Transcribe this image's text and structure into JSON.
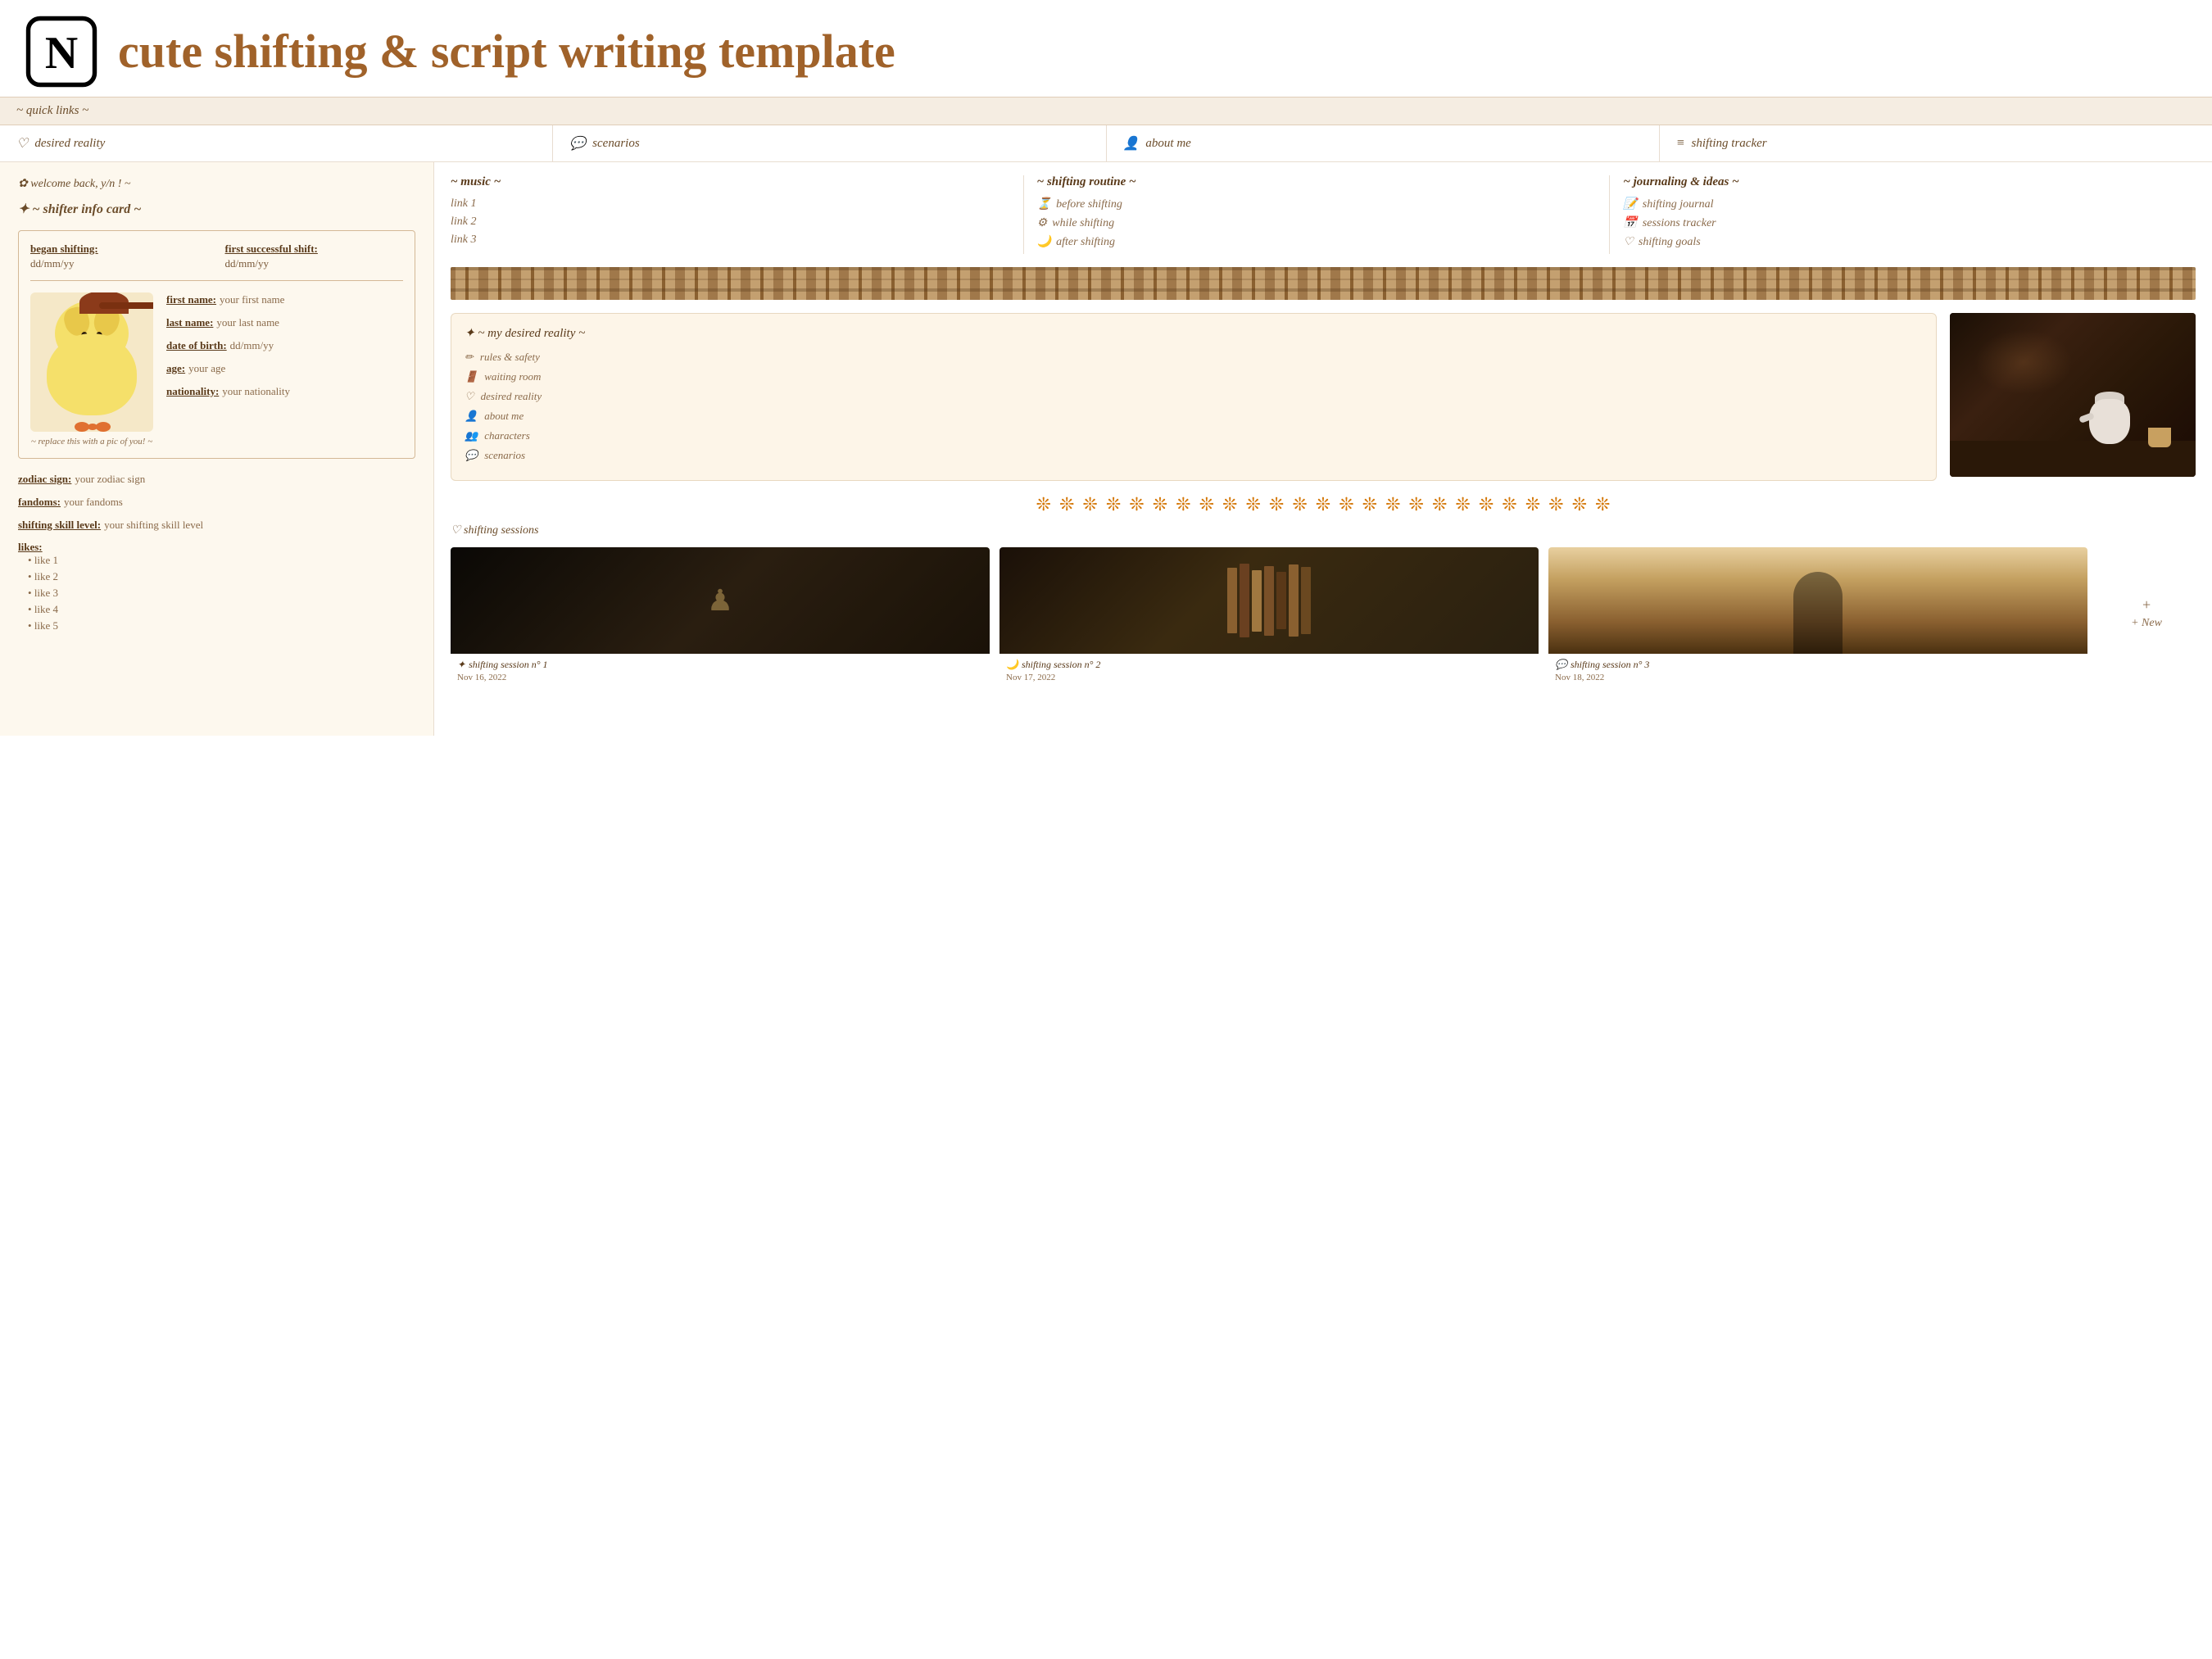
{
  "header": {
    "title": "cute shifting & script writing template",
    "notion_alt": "Notion logo"
  },
  "quick_links_bar": {
    "label": "~ quick links ~"
  },
  "quick_links": [
    {
      "id": "desired-reality",
      "icon": "♡",
      "label": "desired reality"
    },
    {
      "id": "scenarios",
      "icon": "💬",
      "label": "scenarios"
    },
    {
      "id": "about-me",
      "icon": "👤",
      "label": "about me"
    },
    {
      "id": "shifting-tracker",
      "icon": "≡",
      "label": "shifting tracker"
    }
  ],
  "left_panel": {
    "welcome": "✿  welcome back, y/n ! ~",
    "info_card_title": "✦  ~ shifter info card ~",
    "began_shifting_label": "began shifting:",
    "began_shifting_value": "dd/mm/yy",
    "first_shift_label": "first successful shift:",
    "first_shift_value": "dd/mm/yy",
    "image_caption": "~ replace this with a pic of you! ~",
    "fields": [
      {
        "label": "first name:",
        "value": "your first name"
      },
      {
        "label": "last name:",
        "value": "your last name"
      },
      {
        "label": "date of birth:",
        "value": "dd/mm/yy"
      },
      {
        "label": "age:",
        "value": "your age"
      },
      {
        "label": "nationality:",
        "value": "your nationality"
      }
    ],
    "bottom_fields": [
      {
        "label": "zodiac sign:",
        "value": "your zodiac sign"
      },
      {
        "label": "fandoms:",
        "value": "your fandoms"
      },
      {
        "label": "shifting skill level:",
        "value": "your shifting skill level"
      }
    ],
    "likes_label": "likes:",
    "likes": [
      "like 1",
      "like 2",
      "like 3",
      "like 4",
      "like 5"
    ]
  },
  "music_section": {
    "title": "~ music ~",
    "links": [
      "link 1",
      "link 2",
      "link 3"
    ]
  },
  "routine_section": {
    "title": "~ shifting routine ~",
    "items": [
      {
        "icon": "⏳",
        "label": "before shifting"
      },
      {
        "icon": "⚙",
        "label": "while shifting"
      },
      {
        "icon": "🌙",
        "label": "after shifting"
      }
    ]
  },
  "journaling_section": {
    "title": "~ journaling & ideas ~",
    "items": [
      {
        "icon": "📝",
        "label": "shifting journal"
      },
      {
        "icon": "📅",
        "label": "sessions tracker"
      },
      {
        "icon": "♡",
        "label": "shifting goals"
      }
    ]
  },
  "desired_reality": {
    "title": "✦  ~ my desired reality ~",
    "links": [
      {
        "icon": "✏",
        "label": "rules & safety"
      },
      {
        "icon": "🚪",
        "label": "waiting room"
      },
      {
        "icon": "♡",
        "label": "desired reality"
      },
      {
        "icon": "👤",
        "label": "about me"
      },
      {
        "icon": "👥",
        "label": "characters"
      },
      {
        "icon": "💬",
        "label": "scenarios"
      }
    ]
  },
  "flowers": [
    "❊",
    "❊",
    "❊",
    "❊",
    "❊",
    "❊",
    "❊",
    "❊",
    "❊",
    "❊",
    "❊",
    "❊",
    "❊",
    "❊",
    "❊",
    "❊",
    "❊",
    "❊",
    "❊",
    "❊",
    "❊",
    "❊",
    "❊",
    "❊",
    "❊"
  ],
  "sessions": {
    "header": "♡ shifting sessions",
    "new_label": "+ New",
    "items": [
      {
        "icon": "✦",
        "name": "shifting session n° 1",
        "date": "Nov 16, 2022",
        "type": "chess"
      },
      {
        "icon": "🌙",
        "name": "shifting session n° 2",
        "date": "Nov 17, 2022",
        "type": "books"
      },
      {
        "icon": "💬",
        "name": "shifting session n° 3",
        "date": "Nov 18, 2022",
        "type": "arch"
      }
    ]
  }
}
